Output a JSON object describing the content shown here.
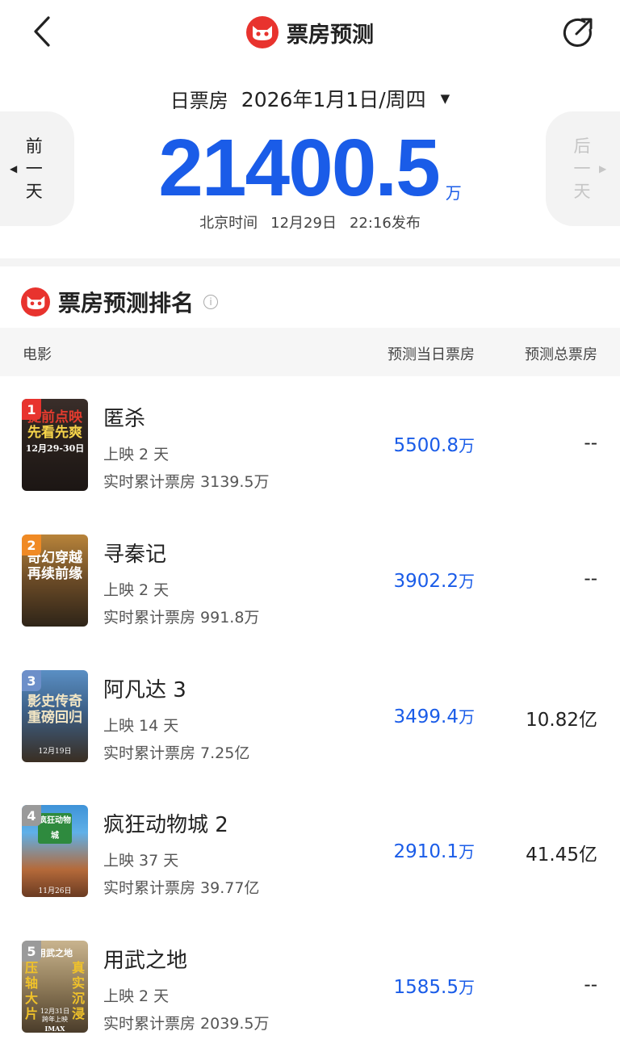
{
  "header": {
    "title": "票房预测"
  },
  "date": {
    "label": "日票房",
    "value": "2026年1月1日/周四",
    "caret": "▼"
  },
  "nav": {
    "prev": [
      "前",
      "一",
      "天"
    ],
    "next": [
      "后",
      "一",
      "天"
    ]
  },
  "summary": {
    "amount": "21400.5",
    "unit": "万"
  },
  "publish": {
    "zone": "北京时间",
    "date": "12月29日",
    "time": "22:16发布"
  },
  "section": {
    "title": "票房预测排名"
  },
  "table": {
    "col_movie": "电影",
    "col_day": "预测当日票房",
    "col_total": "预测总票房",
    "rows": [
      {
        "rank": "1",
        "title": "匿杀",
        "days": "上映 2 天",
        "cumulative": "实时累计票房 3139.5万",
        "day": "5500.8",
        "unit": "万",
        "total": "--"
      },
      {
        "rank": "2",
        "title": "寻秦记",
        "days": "上映 2 天",
        "cumulative": "实时累计票房 991.8万",
        "day": "3902.2",
        "unit": "万",
        "total": "--"
      },
      {
        "rank": "3",
        "title": "阿凡达 3",
        "days": "上映 14 天",
        "cumulative": "实时累计票房 7.25亿",
        "day": "3499.4",
        "unit": "万",
        "total": "10.82亿"
      },
      {
        "rank": "4",
        "title": "疯狂动物城 2",
        "days": "上映 37 天",
        "cumulative": "实时累计票房 39.77亿",
        "day": "2910.1",
        "unit": "万",
        "total": "41.45亿"
      },
      {
        "rank": "5",
        "title": "用武之地",
        "days": "上映 2 天",
        "cumulative": "实时累计票房 2039.5万",
        "day": "1585.5",
        "unit": "万",
        "total": "--"
      }
    ]
  },
  "posters": [
    {
      "lines": [
        "提前点映",
        "先看先爽",
        "12月29-30日"
      ]
    },
    {
      "lines": [
        "奇幻穿越",
        "再续前缘"
      ]
    },
    {
      "lines": [
        "影史传奇",
        "重磅回归",
        "12月19日"
      ]
    },
    {
      "lines": [
        "疯狂动物城",
        "11月26日"
      ]
    },
    {
      "lines": [
        "用武之地",
        "压轴大片",
        "真实沉浸",
        "12月31日",
        "跨年上映",
        "IMAX"
      ]
    }
  ],
  "colors": {
    "accent": "#1a5ce8",
    "logo": "#e8332e",
    "rank_badges": [
      "#e8332e",
      "#f08a24",
      "#6d8fc9",
      "#9a9a9a",
      "#9a9a9a"
    ]
  },
  "icons": {
    "back": "chevron-left-icon",
    "share": "share-arrow-icon",
    "logo": "cat-logo-icon",
    "info": "info-icon"
  }
}
